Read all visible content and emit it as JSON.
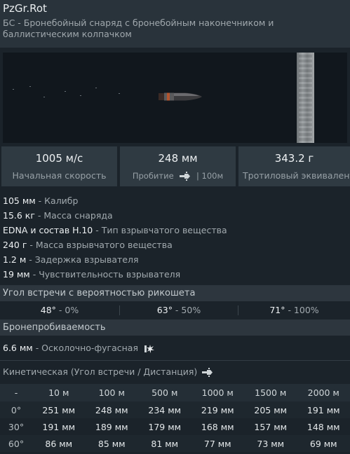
{
  "header": {
    "title": "PzGr.Rot",
    "subtitle": "БС - Бронебойный снаряд с бронебойным наконечником и баллистическим колпачком"
  },
  "stats": {
    "velocity": {
      "value": "1005 м/с",
      "label": "Начальная скорость"
    },
    "penetration": {
      "value": "248 мм",
      "label": "Пробитие",
      "suffix": "| 100м",
      "icon": "armor-pierce-icon"
    },
    "tnt": {
      "value": "343.2 г",
      "label": "Тротиловый эквивалент"
    }
  },
  "properties": [
    {
      "value": "105 мм",
      "desc": " - Калибр"
    },
    {
      "value": "15.6 кг",
      "desc": " - Масса снаряда"
    },
    {
      "value": "EDNA и состав H.10",
      "desc": " - Тип взрывчатого вещества"
    },
    {
      "value": "240 г",
      "desc": " - Масса взрывчатого вещества"
    },
    {
      "value": "1.2 м",
      "desc": " - Задержка взрывателя"
    },
    {
      "value": "19 мм",
      "desc": " - Чувствительность взрывателя"
    }
  ],
  "ricochet": {
    "title": "Угол встречи с вероятностью рикошета",
    "items": [
      {
        "angle": "48°",
        "prob": " - 0%"
      },
      {
        "angle": "63°",
        "prob": " - 50%"
      },
      {
        "angle": "71°",
        "prob": " - 100%"
      }
    ]
  },
  "armor": {
    "title": "Бронепробиваемость",
    "he_value": "6.6 мм",
    "he_desc": " - Осколочно-фугасная",
    "he_icon": "explosion-icon",
    "kinetic_title": "Кинетическая (Угол встречи / Дистанция)",
    "kinetic_icon": "armor-pierce-icon"
  },
  "table": {
    "columns": [
      "-",
      "10 м",
      "100 м",
      "500 м",
      "1000 м",
      "1500 м",
      "2000 м"
    ],
    "rows": [
      [
        "0°",
        "251 мм",
        "248 мм",
        "234 мм",
        "219 мм",
        "205 мм",
        "191 мм"
      ],
      [
        "30°",
        "191 мм",
        "189 мм",
        "179 мм",
        "168 мм",
        "157 мм",
        "148 мм"
      ],
      [
        "60°",
        "86 мм",
        "85 мм",
        "81 мм",
        "77 мм",
        "73 мм",
        "69 мм"
      ]
    ]
  }
}
